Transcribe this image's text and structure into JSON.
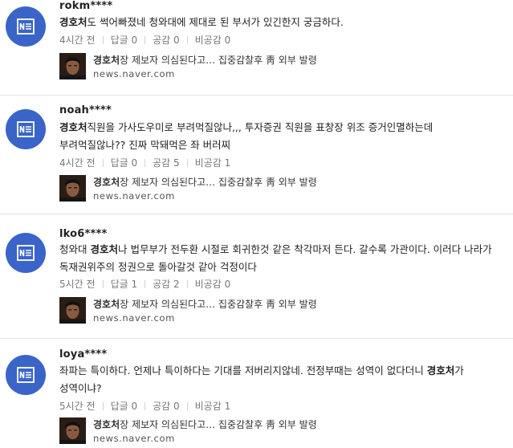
{
  "icons": {
    "avatar": "naver-news-icon"
  },
  "colors": {
    "avatar_bg": "#3a64c8",
    "text": "#222222",
    "meta": "#777777"
  },
  "comments": [
    {
      "author": "rokm****",
      "body_keyword": "경호처",
      "body_rest": "도 썩어빠졌네 청와대에 제대로 된 부서가 있긴한지 궁금하다.",
      "time": "4시간 전",
      "reply": "답글 0",
      "like": "공감 0",
      "dislike": "비공감 0",
      "news_keyword": "경호처",
      "news_rest": "장 제보자 의심된다고… 집중감찰후 靑 외부 발령",
      "news_source": "news.naver.com"
    },
    {
      "author": "noah****",
      "body_keyword": "경호처",
      "body_rest": "직원을 가사도우미로 부려먹질않나,,, 투자증권 직원을 표창장 위조 증거인멸하는데 부려먹질않나?? 진짜 막돼먹은 좌 버러찌",
      "time": "4시간 전",
      "reply": "답글 0",
      "like": "공감 5",
      "dislike": "비공감 1",
      "news_keyword": "경호처",
      "news_rest": "장 제보자 의심된다고… 집중감찰후 靑 외부 발령",
      "news_source": "news.naver.com"
    },
    {
      "author": "lko6****",
      "body_before": "청와대 ",
      "body_keyword": "경호처",
      "body_rest": "나 법무부가 전두환 시절로 회귀한것 같은 착각마저 든다. 갈수록 가관이다. 이러다 나라가 독재권위주의 정권으로 돌아갈것 같아 걱정이다",
      "time": "5시간 전",
      "reply": "답글 1",
      "like": "공감 2",
      "dislike": "비공감 0",
      "news_keyword": "경호처",
      "news_rest": "장 제보자 의심된다고… 집중감찰후 靑 외부 발령",
      "news_source": "news.naver.com"
    },
    {
      "author": "loya****",
      "body_before": "좌파는 특이하다. 언제나 특이하다는 기대를 저버리지않네. 전정부때는 성역이 없다더니 ",
      "body_keyword": "경호처",
      "body_rest": "가 성역이냐?",
      "time": "5시간 전",
      "reply": "답글 0",
      "like": "공감 0",
      "dislike": "비공감 1",
      "news_keyword": "경호처",
      "news_rest": "장 제보자 의심된다고… 집중감찰후 靑 외부 발령",
      "news_source": "news.naver.com"
    }
  ]
}
